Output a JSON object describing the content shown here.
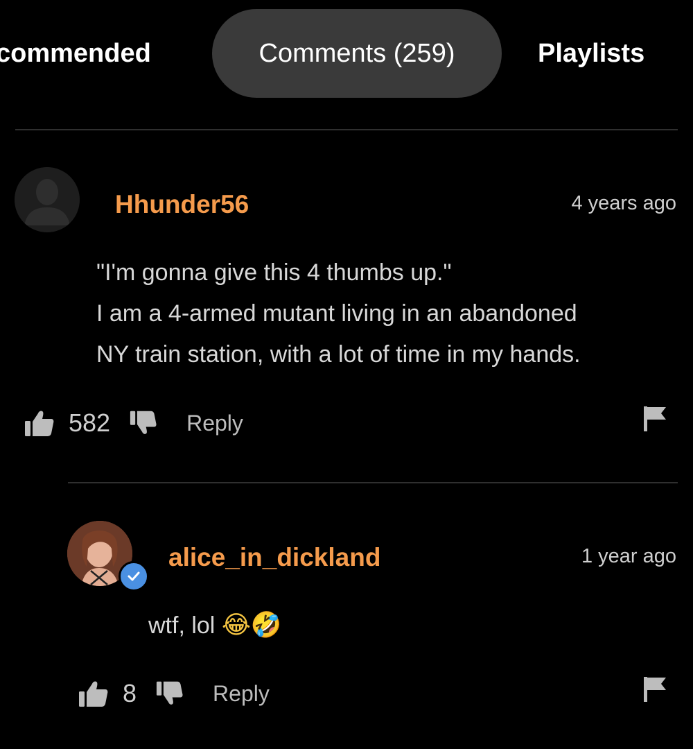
{
  "tabs": {
    "recommended": "commended",
    "comments": "Comments (259)",
    "playlists": "Playlists"
  },
  "comments": [
    {
      "username": "Hhunder56",
      "timestamp": "4 years ago",
      "lines": [
        "\"I'm gonna give this 4 thumbs up.\"",
        "I am a 4-armed mutant living in an abandoned",
        "NY train station, with a lot of time in my hands."
      ],
      "likes": "582",
      "reply_label": "Reply",
      "avatar": "default-avatar-icon"
    },
    {
      "username": "alice_in_dickland",
      "timestamp": "1 year ago",
      "text": "wtf, lol",
      "emojis": "😂🤣",
      "likes": "8",
      "reply_label": "Reply",
      "verified": true
    }
  ],
  "colors": {
    "background": "#000000",
    "username": "#f59b4c",
    "active_tab": "#3a3a3a",
    "verified": "#4a90e2"
  }
}
